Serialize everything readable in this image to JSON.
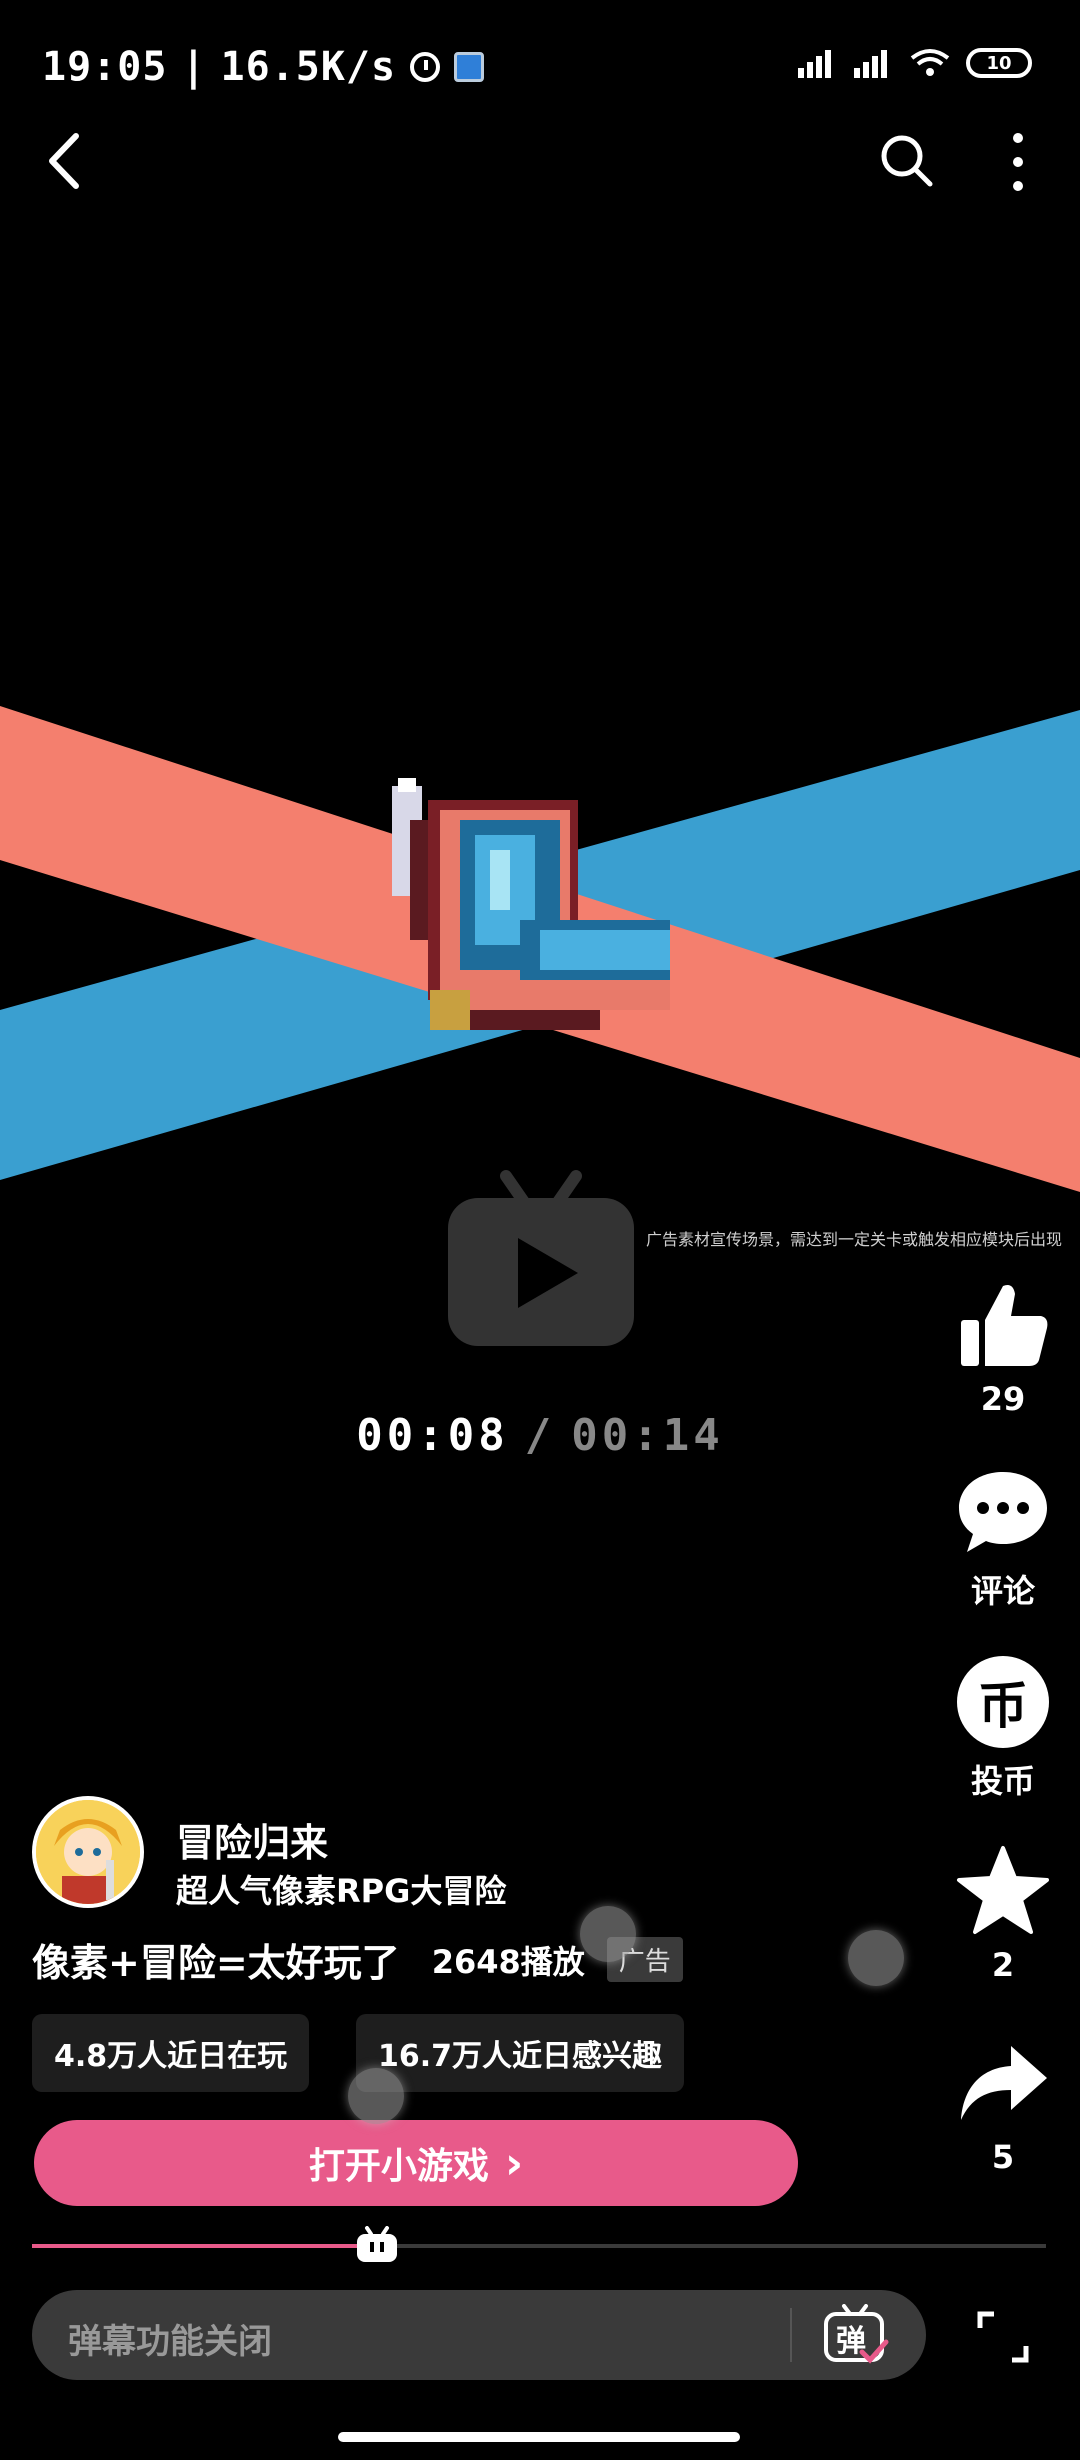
{
  "status_bar": {
    "time": "19:05",
    "net_speed": "16.5K/s",
    "battery": "10"
  },
  "player": {
    "current_time": "00:08",
    "separator": "/",
    "duration": "00:14",
    "ad_note": "广告素材宣传场景，需达到一定关卡或触发相应模块后出现",
    "progress": 0.34
  },
  "actions": {
    "like_count": "29",
    "comment_label": "评论",
    "coin_label": "投币",
    "coin_glyph": "币",
    "favorite_count": "2",
    "share_count": "5"
  },
  "game": {
    "name": "冒险归来",
    "slogan": "超人气像素RPG大冒险",
    "video_title": "像素+冒险=太好玩了",
    "play_count": "2648播放",
    "ad_badge": "广告",
    "stats": [
      "4.8万人近日在玩",
      "16.7万人近日感兴趣"
    ],
    "open_button": "打开小游戏",
    "open_chevron": "›"
  },
  "danmaku": {
    "placeholder": "弹幕功能关闭",
    "toggle_glyph": "弹"
  },
  "colors": {
    "accent": "#e85a8a",
    "stripe_red": "#f47f6e",
    "stripe_blue": "#3a9fd0"
  }
}
